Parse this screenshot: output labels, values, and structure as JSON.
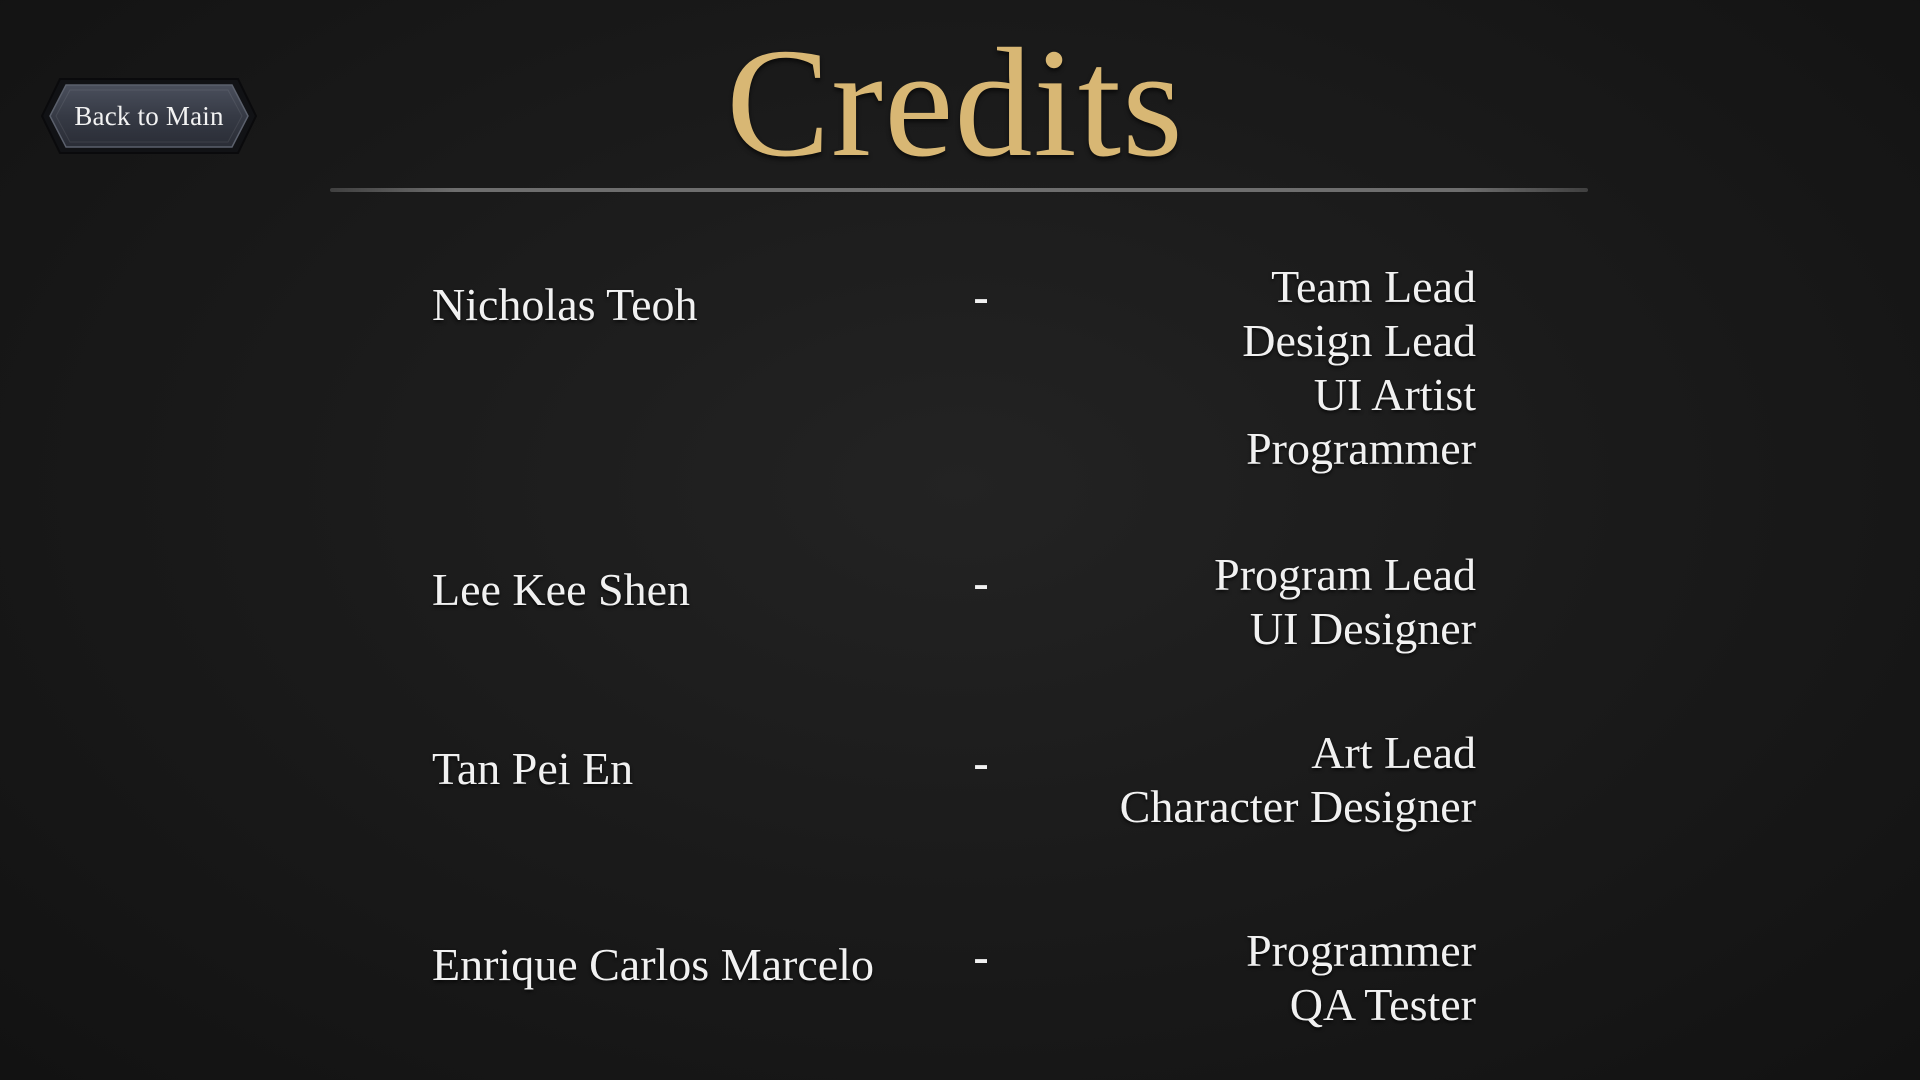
{
  "screen": {
    "title": "Credits",
    "back_button_label": "Back to Main"
  },
  "colors": {
    "background": "#1b1b1b",
    "title_gold": "#d8b774",
    "text": "#f1f1f1",
    "button_fill": "#3a3e4a",
    "button_border": "#15161a"
  },
  "credits": [
    {
      "name": "Nicholas Teoh",
      "separator": "-",
      "roles": [
        "Team Lead",
        "Design Lead",
        "UI Artist",
        "Programmer"
      ]
    },
    {
      "name": "Lee Kee Shen",
      "separator": "-",
      "roles": [
        "Program Lead",
        "UI Designer"
      ]
    },
    {
      "name": "Tan Pei En",
      "separator": "-",
      "roles": [
        "Art Lead",
        "Character Designer"
      ]
    },
    {
      "name": "Enrique Carlos Marcelo",
      "separator": "-",
      "roles": [
        "Programmer",
        "QA Tester"
      ]
    }
  ]
}
